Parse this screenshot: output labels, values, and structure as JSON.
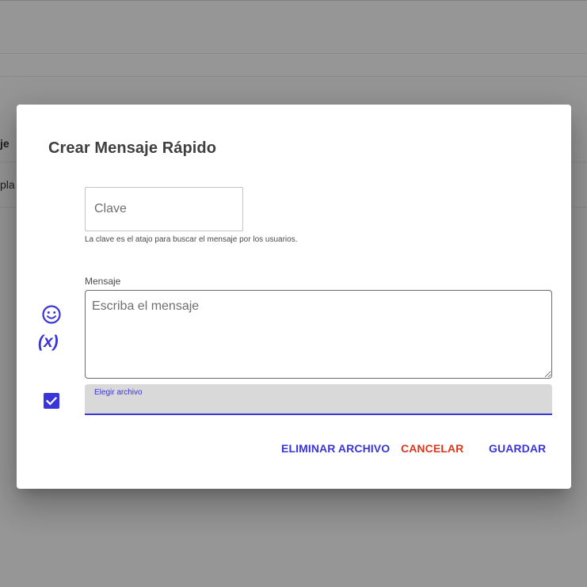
{
  "background": {
    "row1_text": "je",
    "row2_text": "pla"
  },
  "dialog": {
    "title": "Crear Mensaje Rápido",
    "key_field": {
      "placeholder": "Clave",
      "value": "",
      "helper_text": "La clave es el atajo para buscar el mensaje por los usuarios."
    },
    "message_field": {
      "label": "Mensaje",
      "placeholder": "Escriba el mensaje",
      "value": ""
    },
    "variables_label": "(x)",
    "icons": {
      "emoji": "smiley-icon",
      "variables": "variable-icon",
      "checkbox": "check-icon"
    },
    "file_field": {
      "label": "Elegir archivo"
    },
    "buttons": {
      "delete_file": "ELIMINAR ARCHIVO",
      "cancel": "CANCELAR",
      "save": "GUARDAR"
    },
    "colors": {
      "primary": "#3a35d8",
      "danger": "#d8391e",
      "overlay": "#969696"
    }
  }
}
